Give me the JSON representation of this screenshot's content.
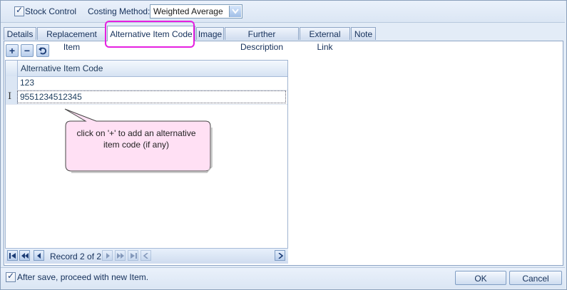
{
  "top": {
    "stock_control_label": "Stock Control",
    "costing_method_label": "Costing Method:",
    "costing_method_value": "Weighted Average"
  },
  "tabs": [
    {
      "label": "Details"
    },
    {
      "label": "Replacement Item"
    },
    {
      "label": "Alternative Item Code",
      "active": true
    },
    {
      "label": "Image"
    },
    {
      "label": "Further Description"
    },
    {
      "label": "External Link"
    },
    {
      "label": "Note"
    }
  ],
  "toolbar": {
    "add_glyph": "+",
    "remove_glyph": "−"
  },
  "grid": {
    "column_header": "Alternative Item Code",
    "rows": [
      "123",
      "9551234512345"
    ]
  },
  "callout": {
    "text_line1": "click on '+' to add an alternative",
    "text_line2": "item code (if any)"
  },
  "navigator": {
    "record_text": "Record 2 of 2"
  },
  "bottom": {
    "after_save_label": "After save, proceed with new Item.",
    "ok_label": "OK",
    "cancel_label": "Cancel"
  },
  "colors": {
    "highlight": "#e620e0",
    "callout_fill": "#ffe0f4"
  }
}
